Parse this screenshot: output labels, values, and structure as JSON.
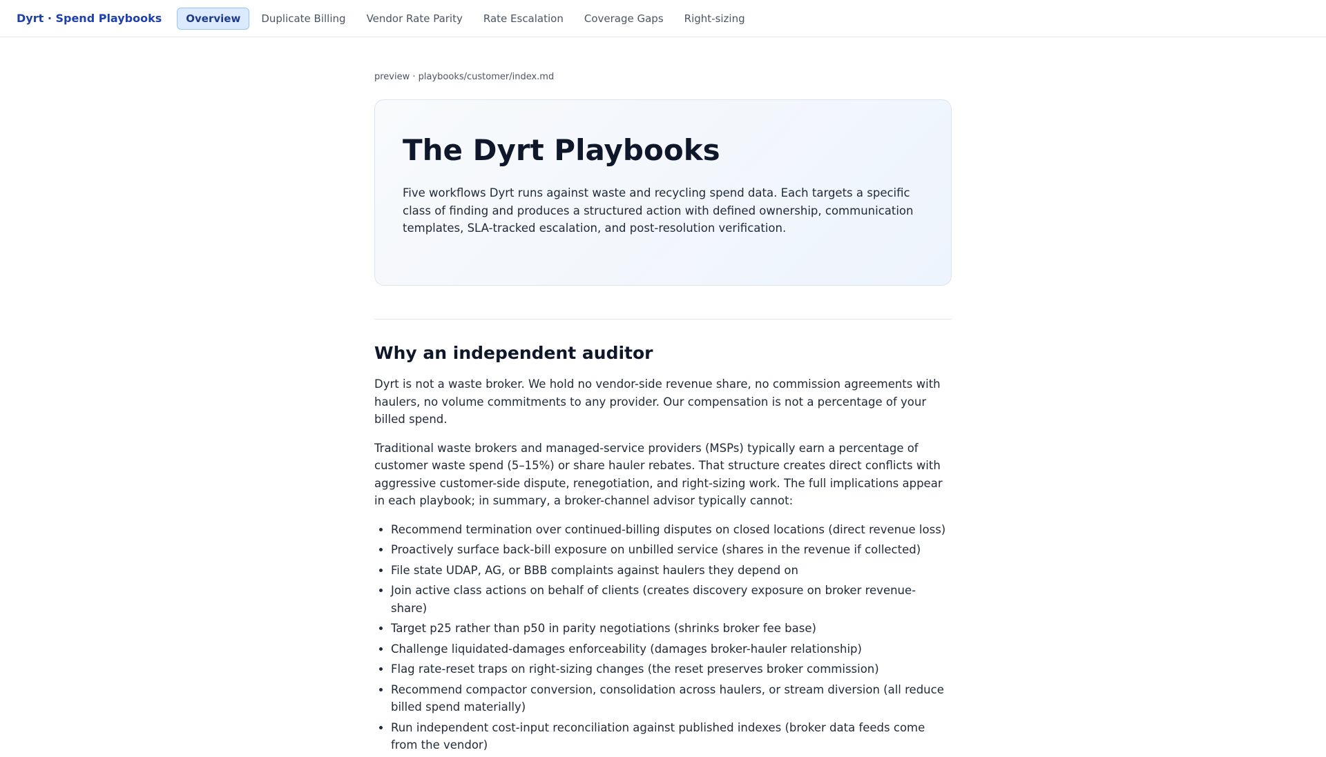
{
  "brand": "Dyrt · Spend Playbooks",
  "nav": {
    "items": [
      {
        "label": "Overview",
        "active": true
      },
      {
        "label": "Duplicate Billing"
      },
      {
        "label": "Vendor Rate Parity"
      },
      {
        "label": "Rate Escalation"
      },
      {
        "label": "Coverage Gaps"
      },
      {
        "label": "Right-sizing"
      }
    ]
  },
  "breadcrumb": "preview · playbooks/customer/index.md",
  "hero": {
    "title": "The Dyrt Playbooks",
    "intro": "Five workflows Dyrt runs against waste and recycling spend data. Each targets a specific class of finding and produces a structured action with defined ownership, communication templates, SLA-tracked escalation, and post-resolution verification."
  },
  "section": {
    "heading": "Why an independent auditor",
    "paragraphs": [
      "Dyrt is not a waste broker. We hold no vendor-side revenue share, no commission agreements with haulers, no volume commitments to any provider. Our compensation is not a percentage of your billed spend.",
      "Traditional waste brokers and managed-service providers (MSPs) typically earn a percentage of customer waste spend (5–15%) or share hauler rebates. That structure creates direct conflicts with aggressive customer-side dispute, renegotiation, and right-sizing work. The full implications appear in each playbook; in summary, a broker-channel advisor typically cannot:"
    ],
    "bullets": [
      "Recommend termination over continued-billing disputes on closed locations (direct revenue loss)",
      "Proactively surface back-bill exposure on unbilled service (shares in the revenue if collected)",
      "File state UDAP, AG, or BBB complaints against haulers they depend on",
      "Join active class actions on behalf of clients (creates discovery exposure on broker revenue-share)",
      "Target p25 rather than p50 in parity negotiations (shrinks broker fee base)",
      "Challenge liquidated-damages enforceability (damages broker-hauler relationship)",
      "Flag rate-reset traps on right-sizing changes (the reset preserves broker commission)",
      "Recommend compactor conversion, consolidation across haulers, or stream diversion (all reduce billed spend materially)",
      "Run independent cost-input reconciliation against published indexes (broker data feeds come from the vendor)"
    ]
  }
}
